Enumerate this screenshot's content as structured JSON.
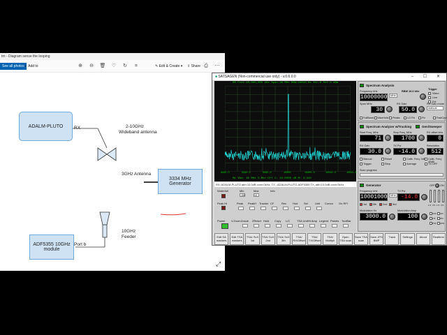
{
  "photos": {
    "title": "tm - Diagram sense the looping",
    "see_all": "See all photos",
    "add_to": "Add to",
    "edit_create": "Edit & Create",
    "share": "Share",
    "toolbar_icons": [
      "zoom-in-icon",
      "zoom-out-icon",
      "delete-icon",
      "favorite-icon",
      "rotate-icon",
      "crop-icon",
      "edit-icon",
      "print-icon",
      "more-icon"
    ]
  },
  "diagram": {
    "adalm": "ADALM-PLUTO",
    "rx": "RX",
    "wideband_l1": "2-10GHz",
    "wideband_l2": "Wideband antenna",
    "antenna3": "3GHz Antenna",
    "gen_l1": "3334 MHz",
    "gen_l2": "Generator",
    "adf_l1": "ADF5355 10GHz",
    "adf_l2": "module",
    "portb": "Port b",
    "feeder_l1": "10GHz",
    "feeder_l2": "Feeder",
    "underline_color": "#e03030"
  },
  "sat": {
    "title": "SATSAGEN (Non-commercial use only) - v.0.6.0.0",
    "window_controls": "–  ☐  ✕",
    "spec_header": "RB  Fcnt:10,000,000 kHz Span:30 MHz RBW:16640 Hz Att:0  Ref:0 dBm",
    "spec_footer": "Mk   Vbw:   10 MHz   S.Mkr:Off   C: 10.0000 dB   M: 3.344",
    "xticks": [
      "9985.0",
      "9990.0",
      "9995.0",
      "10000",
      "10005.0",
      "10010.0",
      "10015.0"
    ],
    "status": "RX: ADALM-PLUTO attn:10.0dB conn:0kHz, TX : ADALM-PLUTO-ADF5355 TX, attn:10.0dB conn:0kHz",
    "trace_color": "#23d7d7",
    "grid_color": "#2a4a2a",
    "controls": {
      "waterfall": "Waterfall",
      "min": "Min",
      "min_val": "-150",
      "max": "Max",
      "max_val": "10",
      "info": "Info",
      "dbm": "dBm",
      "peak_hi": "Peak Hi",
      "peak_labels": [
        "Peak",
        "PeakH",
        "Tracker",
        "CF",
        "Rec",
        "Hud",
        "Sel",
        "Unit"
      ],
      "unit_val": "dBm",
      "cursor": "Cursor",
      "on_rfi": "On RFI",
      "power": "Power",
      "vzoom": "V.Zoom",
      "row3": [
        "Zcsub",
        "ZReset",
        "Hold",
        "Copy",
        "L/C",
        "TSA Unit",
        "HI Amp",
        "Legend",
        "Panels",
        "ToolBar"
      ]
    },
    "bottom_buttons": [
      "Edit SA markers",
      "Edit TSA markers",
      "TSA/ SvX 1st",
      "TSA/ SvX 2nd",
      "TSA/ SvX 3th",
      "TSA/ RX/Offset",
      "TSA/ TX/Offset",
      "TSA/ Multipli",
      "Open TSA scan",
      "Save TSA scan",
      "Save JPG BMP",
      "Track",
      "Settings",
      "About",
      "Realtime"
    ],
    "analysis": {
      "title": "Spectrum Analysis",
      "freq_label": "Frequency kHz",
      "freq": "10000000",
      "mhz": "MHz",
      "rbw_label": "RBW 16.6 kHz",
      "trigger": "Trigger",
      "trig_opts": [
        "Video",
        "Line",
        "Ext"
      ],
      "span_label": "Span MHz",
      "span": "30",
      "rxgain_label": "RX Gain",
      "rxgain": "50.0",
      "rxmode_label": "RX Gain mode",
      "rxmode": "manual",
      "checks": [
        "FullBand",
        "MaxHold",
        "Peaks",
        "LO Fix",
        "Fix",
        "FastCycle"
      ]
    },
    "tracking": {
      "title": "Spectrum Analyzer w/Tracking",
      "sweeper": "Gen/Sweeper",
      "start_label": "Start Freq. MHz",
      "start": "71",
      "stop_label": "Stop Freq. MHz",
      "stop": "1700",
      "rxoff_label": "RX offset kHz",
      "rxoff": "0",
      "rxgain_label": "RX Gain",
      "rxgain": "30.0",
      "txpw_label": "TX Pw",
      "txpw": "-14.0",
      "res_label": "Resolution",
      "res": "512",
      "checks": [
        "Manual",
        "Reset",
        "Calib. Freq. 0dB",
        "Calib. Freq. 40dB",
        "Trigger",
        "Step",
        "Average",
        "TX OFF"
      ]
    },
    "scan_progress": "Scan progress",
    "generator": {
      "title": "Generator",
      "freq_label": "Frequency kHz",
      "freq": "10001000",
      "mhz": "MHz",
      "txpw_label": "TX Pw",
      "txpw": "-14.0",
      "off": "OFF",
      "on": "ON",
      "ch_labels": [
        "1st",
        "5th",
        "2nd",
        "3rd"
      ],
      "mod_label": "Modulation Hz",
      "mod": "3000.0",
      "amp_label": "Modulation Amp",
      "amp": "100",
      "mod_checks": [
        "OFF",
        "AM",
        "FM",
        "PM",
        "PSK",
        "APR"
      ],
      "scale": [
        "1.5",
        "3.5",
        "1.5",
        "3.5"
      ]
    }
  }
}
